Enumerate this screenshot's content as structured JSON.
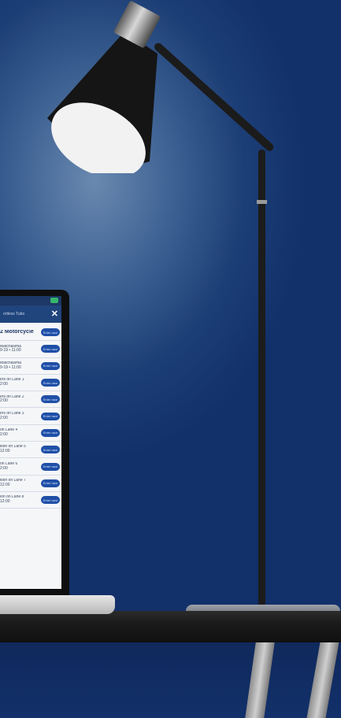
{
  "window": {
    "header_title": "ortless Tubo",
    "close_icon": "close-icon"
  },
  "events": [
    {
      "line1": "2 Motorcycle",
      "line2": "",
      "action": "Enter race"
    },
    {
      "line1": "Matchasima",
      "line2": "9-19 • 11:00",
      "action": "Enter race"
    },
    {
      "line1": "Matchasima",
      "line2": "9-19 • 11:00",
      "action": "Enter race"
    },
    {
      "line1": "ers on Lane 1",
      "line2": "2:00",
      "action": "Enter race"
    },
    {
      "line1": "ers on Lane 2",
      "line2": "2:00",
      "action": "Enter race"
    },
    {
      "line1": "ers on Lane 3",
      "line2": "2:00",
      "action": "Enter race"
    },
    {
      "line1": "on Lane 4",
      "line2": "2:00",
      "action": "Enter race"
    },
    {
      "line1": "ition on Lane 5",
      "line2": "12:00",
      "action": "Enter race"
    },
    {
      "line1": "on Lane 6",
      "line2": "2:00",
      "action": "Enter race"
    },
    {
      "line1": "ition on Lane 7",
      "line2": "12:00",
      "action": "Enter race"
    },
    {
      "line1": "ion on Lane 8",
      "line2": "12:00",
      "action": "Enter race"
    }
  ],
  "colors": {
    "background": "#12306a",
    "header": "#20457d",
    "button": "#1f4fa6",
    "badge": "#35b66b"
  }
}
